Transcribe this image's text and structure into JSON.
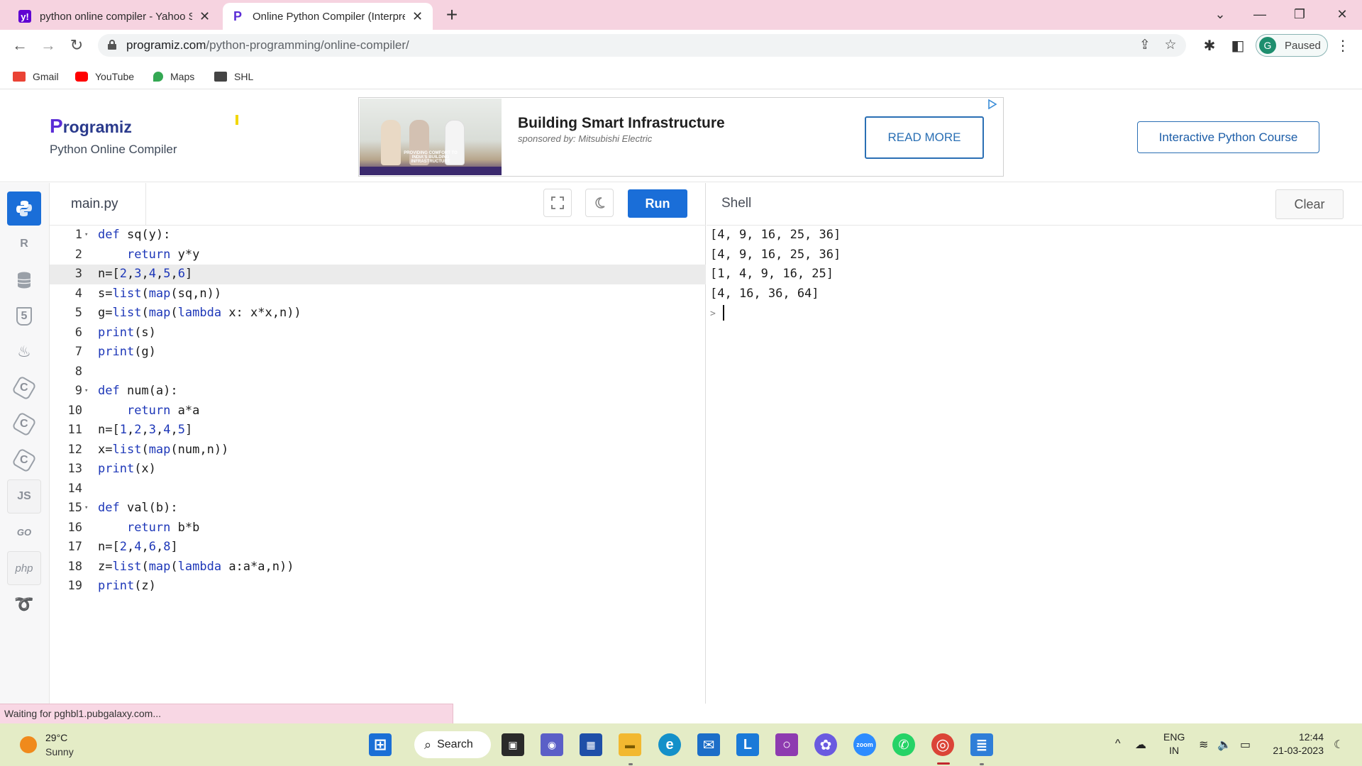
{
  "browser": {
    "tabs": [
      {
        "title": "python online compiler - Yahoo Search Results",
        "active": false
      },
      {
        "title": "Online Python Compiler (Interpreter)",
        "active": true
      }
    ],
    "new_tab": "+",
    "window_controls": {
      "minimize": "—",
      "restore": "❐",
      "close": "✕",
      "tab_search": "⌄"
    },
    "nav": {
      "back": "←",
      "forward": "→",
      "reload": "↻"
    },
    "url_host": "programiz.com",
    "url_path": "/python-programming/online-compiler/",
    "profile": {
      "initial": "G",
      "status": "Paused"
    },
    "bookmarks": [
      {
        "label": "Gmail",
        "color": "#ea4335"
      },
      {
        "label": "YouTube",
        "color": "#ff0000"
      },
      {
        "label": "Maps",
        "color": "#34a853"
      },
      {
        "label": "SHL",
        "color": "#444444"
      }
    ]
  },
  "site": {
    "logo_first": "P",
    "logo_rest": "rogramiz",
    "subtitle": "Python Online Compiler",
    "ad": {
      "title": "Building Smart Infrastructure",
      "sponsor": "sponsored by: Mitsubishi Electric",
      "cta": "READ MORE",
      "image_caption": "PROVIDING COMFORT TO INDIA'S BUILDING INFRASTRUCTURE"
    },
    "course_button": "Interactive Python Course"
  },
  "languages": [
    {
      "name": "python",
      "glyph": "",
      "active": true
    },
    {
      "name": "r",
      "glyph": "R"
    },
    {
      "name": "sql",
      "glyph": ""
    },
    {
      "name": "html",
      "glyph": "5"
    },
    {
      "name": "java",
      "glyph": "♨"
    },
    {
      "name": "c",
      "glyph": "C"
    },
    {
      "name": "cpp",
      "glyph": "C"
    },
    {
      "name": "csharp",
      "glyph": "C"
    },
    {
      "name": "js",
      "glyph": "JS"
    },
    {
      "name": "go",
      "glyph": "GO"
    },
    {
      "name": "php",
      "glyph": "php"
    },
    {
      "name": "swift",
      "glyph": "➰"
    }
  ],
  "editor": {
    "filename": "main.py",
    "run_label": "Run",
    "lines": [
      {
        "n": "1",
        "fold": true,
        "tokens": [
          [
            "kw",
            "def"
          ],
          [
            "t",
            " sq(y):"
          ]
        ]
      },
      {
        "n": "2",
        "tokens": [
          [
            "t",
            "    "
          ],
          [
            "kw",
            "return"
          ],
          [
            "t",
            " y*y"
          ]
        ]
      },
      {
        "n": "3",
        "highlight": true,
        "tokens": [
          [
            "t",
            "n=["
          ],
          [
            "num",
            "2"
          ],
          [
            "t",
            ","
          ],
          [
            "num",
            "3"
          ],
          [
            "t",
            ","
          ],
          [
            "num",
            "4"
          ],
          [
            "t",
            ","
          ],
          [
            "num",
            "5"
          ],
          [
            "t",
            ","
          ],
          [
            "num",
            "6"
          ],
          [
            "t",
            "]"
          ]
        ]
      },
      {
        "n": "4",
        "tokens": [
          [
            "t",
            "s="
          ],
          [
            "bi",
            "list"
          ],
          [
            "t",
            "("
          ],
          [
            "bi",
            "map"
          ],
          [
            "t",
            "(sq,n))"
          ]
        ]
      },
      {
        "n": "5",
        "tokens": [
          [
            "t",
            "g="
          ],
          [
            "bi",
            "list"
          ],
          [
            "t",
            "("
          ],
          [
            "bi",
            "map"
          ],
          [
            "t",
            "("
          ],
          [
            "kw",
            "lambda"
          ],
          [
            "t",
            " x: x*x,n))"
          ]
        ]
      },
      {
        "n": "6",
        "tokens": [
          [
            "bi",
            "print"
          ],
          [
            "t",
            "(s)"
          ]
        ]
      },
      {
        "n": "7",
        "tokens": [
          [
            "bi",
            "print"
          ],
          [
            "t",
            "(g)"
          ]
        ]
      },
      {
        "n": "8",
        "tokens": []
      },
      {
        "n": "9",
        "fold": true,
        "tokens": [
          [
            "kw",
            "def"
          ],
          [
            "t",
            " num(a):"
          ]
        ]
      },
      {
        "n": "10",
        "tokens": [
          [
            "t",
            "    "
          ],
          [
            "kw",
            "return"
          ],
          [
            "t",
            " a*a"
          ]
        ]
      },
      {
        "n": "11",
        "tokens": [
          [
            "t",
            "n=["
          ],
          [
            "num",
            "1"
          ],
          [
            "t",
            ","
          ],
          [
            "num",
            "2"
          ],
          [
            "t",
            ","
          ],
          [
            "num",
            "3"
          ],
          [
            "t",
            ","
          ],
          [
            "num",
            "4"
          ],
          [
            "t",
            ","
          ],
          [
            "num",
            "5"
          ],
          [
            "t",
            "]"
          ]
        ]
      },
      {
        "n": "12",
        "tokens": [
          [
            "t",
            "x="
          ],
          [
            "bi",
            "list"
          ],
          [
            "t",
            "("
          ],
          [
            "bi",
            "map"
          ],
          [
            "t",
            "(num,n))"
          ]
        ]
      },
      {
        "n": "13",
        "tokens": [
          [
            "bi",
            "print"
          ],
          [
            "t",
            "(x)"
          ]
        ]
      },
      {
        "n": "14",
        "tokens": []
      },
      {
        "n": "15",
        "fold": true,
        "tokens": [
          [
            "kw",
            "def"
          ],
          [
            "t",
            " val(b):"
          ]
        ]
      },
      {
        "n": "16",
        "tokens": [
          [
            "t",
            "    "
          ],
          [
            "kw",
            "return"
          ],
          [
            "t",
            " b*b"
          ]
        ]
      },
      {
        "n": "17",
        "tokens": [
          [
            "t",
            "n=["
          ],
          [
            "num",
            "2"
          ],
          [
            "t",
            ","
          ],
          [
            "num",
            "4"
          ],
          [
            "t",
            ","
          ],
          [
            "num",
            "6"
          ],
          [
            "t",
            ","
          ],
          [
            "num",
            "8"
          ],
          [
            "t",
            "]"
          ]
        ]
      },
      {
        "n": "18",
        "tokens": [
          [
            "t",
            "z="
          ],
          [
            "bi",
            "list"
          ],
          [
            "t",
            "("
          ],
          [
            "bi",
            "map"
          ],
          [
            "t",
            "("
          ],
          [
            "kw",
            "lambda"
          ],
          [
            "t",
            " a:a*a,n))"
          ]
        ]
      },
      {
        "n": "19",
        "tokens": [
          [
            "bi",
            "print"
          ],
          [
            "t",
            "(z)"
          ]
        ]
      }
    ]
  },
  "shell": {
    "title": "Shell",
    "clear_label": "Clear",
    "output": [
      "[4, 9, 16, 25, 36]",
      "[4, 9, 16, 25, 36]",
      "[1, 4, 9, 16, 25]",
      "[4, 16, 36, 64]"
    ],
    "prompt": ">"
  },
  "status_text": "Waiting for pghbl1.pubgalaxy.com...",
  "taskbar": {
    "weather_temp": "29°C",
    "weather_cond": "Sunny",
    "search_label": "Search",
    "lang_top": "ENG",
    "lang_bottom": "IN",
    "time": "12:44",
    "date": "21-03-2023",
    "apps": [
      {
        "name": "start",
        "color": "#1b6fd6",
        "glyph": "⊞"
      },
      {
        "name": "task-view",
        "color": "#2a2a2a",
        "glyph": "▣"
      },
      {
        "name": "teams",
        "color": "#5b5fc7",
        "glyph": "◉"
      },
      {
        "name": "store",
        "color": "#1f4fa8",
        "glyph": "▦"
      },
      {
        "name": "file-explorer",
        "color": "#f2b830",
        "glyph": "▬"
      },
      {
        "name": "edge",
        "color": "#1490c9",
        "glyph": "e"
      },
      {
        "name": "mail",
        "color": "#1c6ec8",
        "glyph": "✉"
      },
      {
        "name": "app-l",
        "color": "#1a7ad8",
        "glyph": "L"
      },
      {
        "name": "app-circle",
        "color": "#8e3bb0",
        "glyph": "○"
      },
      {
        "name": "app-flower",
        "color": "#6a5ae0",
        "glyph": "✿"
      },
      {
        "name": "zoom",
        "color": "#2d8cff",
        "glyph": "zoom"
      },
      {
        "name": "whatsapp",
        "color": "#25d366",
        "glyph": "✆"
      },
      {
        "name": "chrome",
        "color": "#db4437",
        "glyph": "◎"
      },
      {
        "name": "notepad",
        "color": "#2f7ed8",
        "glyph": "≣"
      }
    ],
    "tray": {
      "chevron": "^",
      "cloud": "☁",
      "wifi": "≋",
      "volume": "🔈",
      "battery": "▭",
      "moon": "☾"
    }
  }
}
